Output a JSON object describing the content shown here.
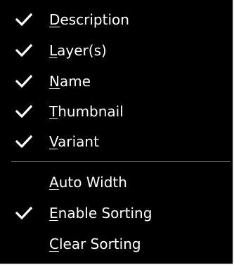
{
  "menu": {
    "items": [
      {
        "mnemonic": "D",
        "rest": "escription",
        "checked": true
      },
      {
        "mnemonic": "L",
        "rest": "ayer(s)",
        "checked": true
      },
      {
        "mnemonic": "N",
        "rest": "ame",
        "checked": true
      },
      {
        "mnemonic": "T",
        "rest": "humbnail",
        "checked": true
      },
      {
        "mnemonic": "V",
        "rest": "ariant",
        "checked": true
      },
      {
        "mnemonic": "A",
        "rest": "uto Width",
        "checked": false
      },
      {
        "mnemonic": "E",
        "rest": "nable Sorting",
        "checked": true
      },
      {
        "mnemonic": "C",
        "rest": "lear Sorting",
        "checked": false
      }
    ]
  },
  "icons": {
    "check": "checkmark-icon"
  },
  "colors": {
    "background": "#000000",
    "text": "#ffffff",
    "separator": "#5a5a5a",
    "border": "#c8c8c8"
  }
}
